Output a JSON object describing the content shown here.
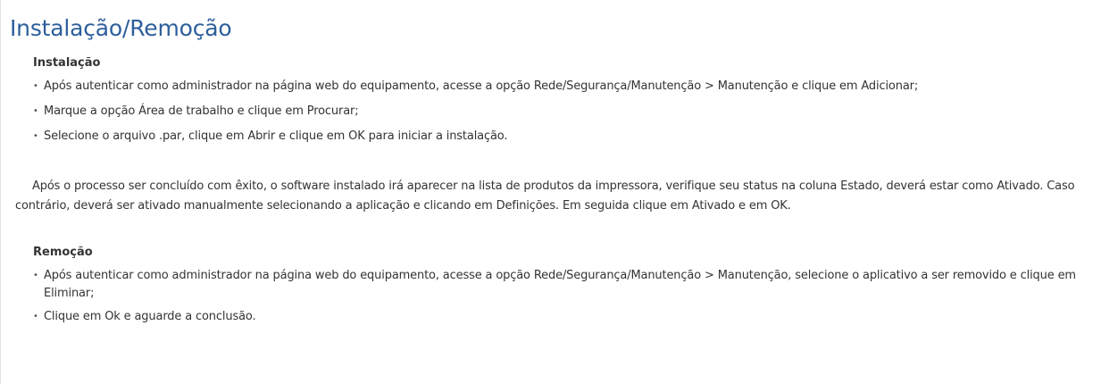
{
  "page": {
    "title": "Instalação/Remoção"
  },
  "installation": {
    "heading": "Instalação",
    "steps": [
      "Após autenticar como administrador na página web do equipamento, acesse a opção Rede/Segurança/Manutenção > Manutenção e clique em Adicionar;",
      "Marque a opção Área de trabalho e clique em Procurar;",
      "Selecione o arquivo .par, clique em Abrir e clique em OK para iniciar a instalação."
    ],
    "note": "Após o processo ser concluído com êxito, o software instalado irá aparecer na lista de produtos da impressora, verifique seu status na coluna Estado, deverá estar como Ativado. Caso contrário, deverá ser ativado manualmente selecionando a aplicação e clicando em Definições. Em seguida clique em Ativado e em OK."
  },
  "removal": {
    "heading": "Remoção",
    "steps": [
      "Após autenticar como administrador na página web do equipamento, acesse a opção Rede/Segurança/Manutenção > Manutenção, selecione o aplicativo a ser removido e clique em Eliminar;",
      "Clique em Ok e aguarde a conclusão."
    ]
  },
  "colors": {
    "title": "#2e5f9c",
    "text": "#333333"
  }
}
